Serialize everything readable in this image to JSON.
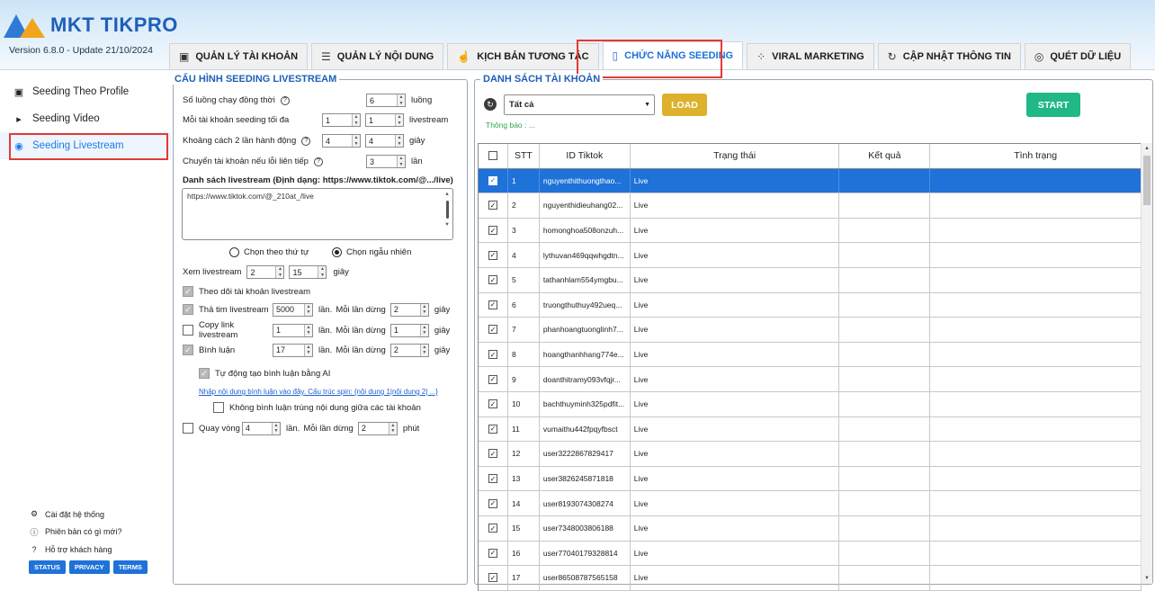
{
  "app": {
    "logo_text": "MKT TIKPRO",
    "version": "Version  6.8.0  - Update  21/10/2024"
  },
  "tabs": [
    {
      "label": "QUẢN LÝ TÀI KHOẢN",
      "icon": "id-card-icon",
      "glyph": "▣",
      "active": false
    },
    {
      "label": "QUẢN LÝ NỘI DUNG",
      "icon": "list-icon",
      "glyph": "☰",
      "active": false
    },
    {
      "label": "KỊCH BẢN TƯƠNG TÁC",
      "icon": "hand-icon",
      "glyph": "☝",
      "active": false
    },
    {
      "label": "CHỨC NĂNG SEEDING",
      "icon": "seeding-icon",
      "glyph": "▯",
      "active": true
    },
    {
      "label": "VIRAL MARKETING",
      "icon": "network-icon",
      "glyph": "⁘",
      "active": false
    },
    {
      "label": "CẬP NHẬT THÔNG TIN",
      "icon": "update-icon",
      "glyph": "↻",
      "active": false
    },
    {
      "label": "QUÉT DỮ LIỆU",
      "icon": "scan-icon",
      "glyph": "◎",
      "active": false
    }
  ],
  "sidebar": {
    "items": [
      {
        "label": "Seeding Theo Profile",
        "icon": "profile-icon",
        "glyph": "▣",
        "active": false
      },
      {
        "label": "Seeding Video",
        "icon": "video-icon",
        "glyph": "▸",
        "active": false
      },
      {
        "label": "Seeding Livestream",
        "icon": "livestream-icon",
        "glyph": "◉",
        "active": true
      }
    ],
    "footer": [
      {
        "label": "Cài đặt hệ thống",
        "icon": "gear-icon",
        "glyph": "⚙"
      },
      {
        "label": "Phiên bản có gì mới?",
        "icon": "info-icon",
        "glyph": "ⓘ"
      },
      {
        "label": "Hỗ trợ khách hàng",
        "icon": "help-icon",
        "glyph": "?"
      }
    ],
    "buttons": [
      "STATUS",
      "PRIVACY",
      "TERMS"
    ]
  },
  "config": {
    "title": "CẤU HÌNH SEEDING LIVESTREAM",
    "threads_label": "Số luồng chạy đồng thời",
    "threads_value": "6",
    "threads_unit": "luồng",
    "max_seed_label": "Mỗi tài khoản seeding tối đa",
    "max_seed_from": "1",
    "max_seed_to": "1",
    "max_seed_unit": "livestream",
    "interval_label": "Khoảng cách 2 lần hành động",
    "interval_from": "4",
    "interval_to": "4",
    "interval_unit": "giây",
    "switch_label": "Chuyển tài khoản nếu lỗi liên tiếp",
    "switch_value": "3",
    "switch_unit": "lần",
    "list_label": "Danh sách livestream (Định dạng: https://www.tiktok.com/@.../live)",
    "url_value": "https://www.tiktok.com/@_210at_/live",
    "radio_order": "Chọn theo thứ tự",
    "radio_random": "Chọn ngẫu nhiên",
    "watch_label": "Xem livestream",
    "watch_from": "2",
    "watch_to": "15",
    "watch_unit": "giây",
    "follow_label": "Theo dõi tài khoản livestream",
    "heart_label": "Thả tim livestream",
    "heart_value": "5000",
    "heart_times": "lần.",
    "heart_wait_label": "Mỗi lần dừng",
    "heart_wait": "2",
    "heart_unit": "giây",
    "copy_label": "Copy link livestream",
    "copy_value": "1",
    "copy_times": "lần.",
    "copy_wait_label": "Mỗi lần dừng",
    "copy_wait": "1",
    "copy_unit": "giây",
    "comment_label": "Bình luận",
    "comment_value": "17",
    "comment_times": "lần.",
    "comment_wait_label": "Mỗi lần dừng",
    "comment_wait": "2",
    "comment_unit": "giây",
    "ai_comment_label": "Tự động tạo bình luận bằng AI",
    "comment_link": "Nhập nội dung bình luận vào đây. Cấu trúc spin: {nội dung 1|nội dung 2| ...}",
    "no_dup_label": "Không bình luận trùng nội dung giữa các tài khoản",
    "loop_label": "Quay vòng",
    "loop_value": "4",
    "loop_times": "lần.",
    "loop_wait_label": "Mỗi lần dừng",
    "loop_wait": "2",
    "loop_unit": "phút"
  },
  "account_list": {
    "title": "DANH SÁCH TÀI KHOẢN",
    "filter_value": "Tất cả",
    "load_label": "LOAD",
    "start_label": "START",
    "notice": "Thông báo : ...",
    "columns": [
      "STT",
      "ID Tiktok",
      "Trạng thái",
      "Kết quả",
      "Tình trạng"
    ],
    "rows": [
      {
        "stt": "1",
        "id": "nguyenthithuongthao...",
        "status": "Live"
      },
      {
        "stt": "2",
        "id": "nguyenthidieuhang02...",
        "status": "Live"
      },
      {
        "stt": "3",
        "id": "homonghoa508onzuh...",
        "status": "Live"
      },
      {
        "stt": "4",
        "id": "lythuvan469qqwhgdtn...",
        "status": "Live"
      },
      {
        "stt": "5",
        "id": "tathanhlam554ymgbu...",
        "status": "Live"
      },
      {
        "stt": "6",
        "id": "truongthuthuy492ueq...",
        "status": "Live"
      },
      {
        "stt": "7",
        "id": "phanhoangtuonglinh7...",
        "status": "Live"
      },
      {
        "stt": "8",
        "id": "hoangthanhhang774e...",
        "status": "Live"
      },
      {
        "stt": "9",
        "id": "doanthitramy093vfqjr...",
        "status": "Live"
      },
      {
        "stt": "10",
        "id": "bachthuyminh325pdfit...",
        "status": "Live"
      },
      {
        "stt": "11",
        "id": "vumaithu442fpqyfbsct",
        "status": "Live"
      },
      {
        "stt": "12",
        "id": "user3222867829417",
        "status": "Live"
      },
      {
        "stt": "13",
        "id": "user3826245871818",
        "status": "Live"
      },
      {
        "stt": "14",
        "id": "user8193074308274",
        "status": "Live"
      },
      {
        "stt": "15",
        "id": "user7348003806188",
        "status": "Live"
      },
      {
        "stt": "16",
        "id": "user77040179328814",
        "status": "Live"
      },
      {
        "stt": "17",
        "id": "user86508787565158",
        "status": "Live"
      }
    ]
  }
}
